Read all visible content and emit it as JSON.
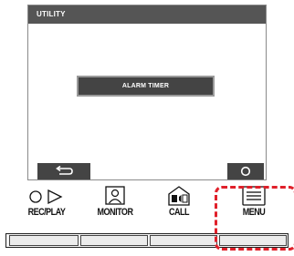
{
  "screen": {
    "header_title": "UTILITY",
    "menu_items": [
      {
        "label": "ALARM TIMER"
      }
    ],
    "back_icon": "return-arrow-icon",
    "ok_icon": "circle-ok-icon"
  },
  "function_keys": [
    {
      "label": "REC/PLAY",
      "icons": [
        "circle-icon",
        "play-triangle-icon"
      ]
    },
    {
      "label": "MONITOR",
      "icons": [
        "person-monitor-icon"
      ]
    },
    {
      "label": "CALL",
      "icons": [
        "call-house-icon"
      ]
    },
    {
      "label": "MENU",
      "icons": [
        "menu-list-icon"
      ]
    }
  ],
  "highlight": {
    "target": "MENU",
    "color": "#e0202a",
    "style": "dashed"
  }
}
